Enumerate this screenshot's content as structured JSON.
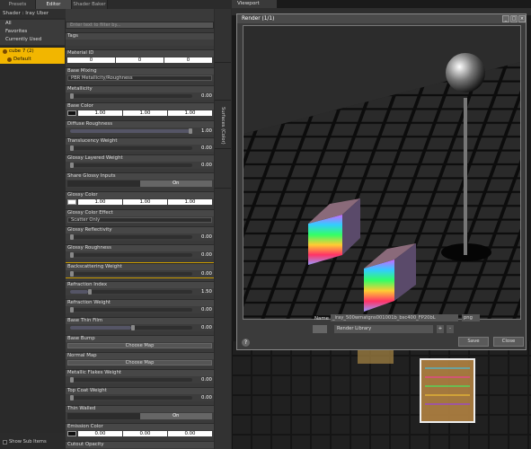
{
  "left_tabs": [
    "Presets",
    "Editor",
    "Shader Baker"
  ],
  "shader_title": "Shader : Iray Uber",
  "filters": [
    "All",
    "Favorites",
    "Currently Used"
  ],
  "tree": [
    {
      "label": "cube 7 (2)"
    },
    {
      "label": "Default"
    }
  ],
  "show_sub_items": "Show Sub Items",
  "search_placeholder": "Enter text to filter by...",
  "properties": {
    "tags": "Tags",
    "material_id": {
      "label": "Material ID",
      "values": [
        "0",
        "0",
        "0"
      ]
    },
    "base_mixing": {
      "label": "Base Mixing",
      "value": "PBR Metallicity/Roughness"
    },
    "metallicity": {
      "label": "Metallicity",
      "value": "0.00",
      "level": 0.0
    },
    "base_color": {
      "label": "Base Color",
      "values": [
        "1.00",
        "1.00",
        "1.00"
      ]
    },
    "diffuse_roughness": {
      "label": "Diffuse Roughness",
      "value": "1.00",
      "level": 1.0
    },
    "translucency_weight": {
      "label": "Translucency Weight",
      "value": "0.00",
      "level": 0.0
    },
    "glossy_layered_weight": {
      "label": "Glossy Layered Weight",
      "value": "0.00",
      "level": 0.0
    },
    "share_glossy_inputs": {
      "label": "Share Glossy Inputs",
      "value": "On"
    },
    "glossy_color": {
      "label": "Glossy Color",
      "values": [
        "1.00",
        "1.00",
        "1.00"
      ]
    },
    "glossy_color_effect": {
      "label": "Glossy Color Effect",
      "value": "Scatter Only"
    },
    "glossy_reflectivity": {
      "label": "Glossy Reflectivity",
      "value": "0.00",
      "level": 0.0
    },
    "glossy_roughness": {
      "label": "Glossy Roughness",
      "value": "0.00",
      "level": 0.0
    },
    "backscattering_weight": {
      "label": "Backscattering Weight",
      "value": "0.00",
      "level": 0.0
    },
    "refraction_index": {
      "label": "Refraction Index",
      "value": "1.50",
      "level": 0.15
    },
    "refraction_weight": {
      "label": "Refraction Weight",
      "value": "0.00",
      "level": 0.0
    },
    "base_thin_film": {
      "label": "Base Thin Film",
      "value": "0.00",
      "level": 0.5
    },
    "base_bump": {
      "label": "Base Bump",
      "button": "Choose Map"
    },
    "normal_map": {
      "label": "Normal Map",
      "button": "Choose Map"
    },
    "metallic_flakes_weight": {
      "label": "Metallic Flakes Weight",
      "value": "0.00",
      "level": 0.0
    },
    "top_coat_weight": {
      "label": "Top Coat Weight",
      "value": "0.00",
      "level": 0.0
    },
    "thin_walled": {
      "label": "Thin Walled",
      "value": "On"
    },
    "emission_color": {
      "label": "Emission Color",
      "values": [
        "0.00",
        "0.00",
        "0.00"
      ]
    },
    "cutout_opacity": {
      "label": "Cutout Opacity"
    }
  },
  "side_tabs": [
    "Surfaces (Color)"
  ],
  "viewport_tab": "Viewport",
  "render_dialog": {
    "title": "Render (1/1)",
    "name_label": "Name",
    "name_value": "_iray_500wmatgns001001b_bsc400_FP20bL",
    "format": "png",
    "library": "Render Library",
    "plus": "+",
    "minus": "-",
    "help": "?",
    "save": "Save",
    "close": "Close"
  },
  "colors": {
    "accent": "#f2b600",
    "panel": "#3a3a3a",
    "highlight_border": "#c89a00"
  }
}
